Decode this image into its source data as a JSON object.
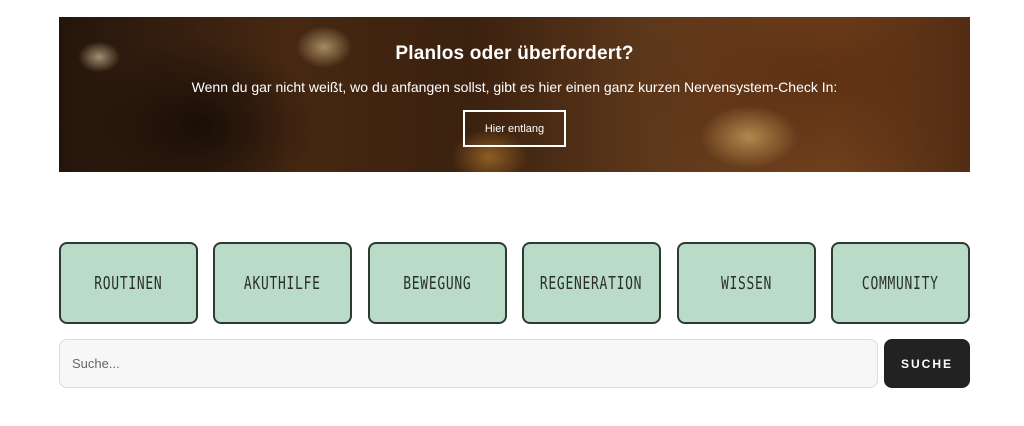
{
  "hero": {
    "title": "Planlos oder überfordert?",
    "text": "Wenn du gar nicht weißt, wo du anfangen sollst, gibt es hier einen ganz kurzen Nervensystem-Check In:",
    "button_label": "Hier entlang"
  },
  "categories": [
    {
      "label": "ROUTINEN"
    },
    {
      "label": "AKUTHILFE"
    },
    {
      "label": "BEWEGUNG"
    },
    {
      "label": "REGENERATION"
    },
    {
      "label": "WISSEN"
    },
    {
      "label": "COMMUNITY"
    }
  ],
  "search": {
    "placeholder": "Suche...",
    "value": "",
    "button_label": "SUCHE"
  },
  "colors": {
    "category_bg": "#b9dbc8",
    "category_border": "#2f3a33",
    "search_button_bg": "#222222"
  }
}
